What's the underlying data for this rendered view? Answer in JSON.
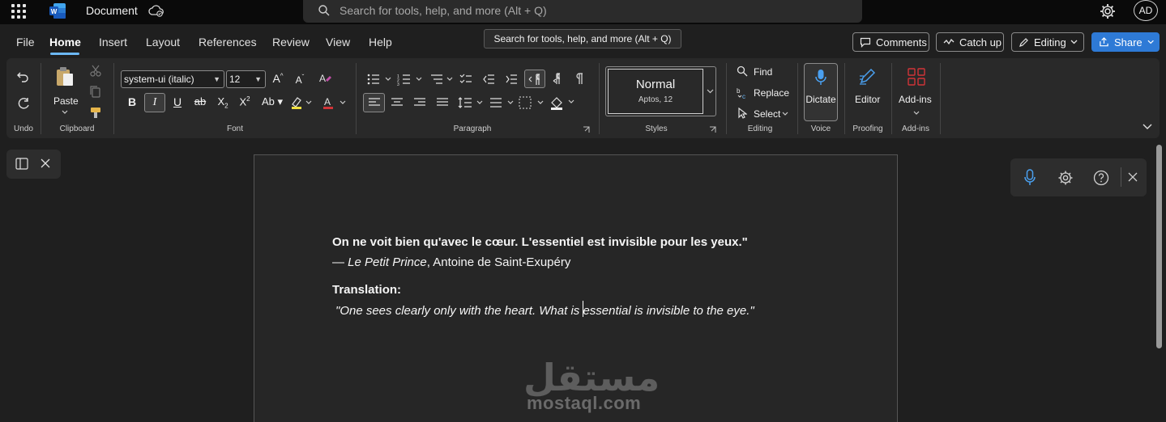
{
  "titlebar": {
    "doc_title": "Document",
    "search_placeholder": "Search for tools, help, and more (Alt + Q)",
    "avatar_initials": "AD"
  },
  "tooltip": "Search for tools, help, and more (Alt + Q)",
  "menu": {
    "tabs": [
      "File",
      "Home",
      "Insert",
      "Layout",
      "References",
      "Review",
      "View",
      "Help"
    ],
    "active": "Home",
    "comments": "Comments",
    "catch_up": "Catch up",
    "editing": "Editing",
    "share": "Share"
  },
  "ribbon": {
    "undo_label": "Undo",
    "paste_label": "Paste",
    "clipboard_label": "Clipboard",
    "font_name": "system-ui (italic)",
    "font_size": "12",
    "font_label": "Font",
    "paragraph_label": "Paragraph",
    "style_name": "Normal",
    "style_sub": "Aptos, 12",
    "styles_label": "Styles",
    "find": "Find",
    "replace": "Replace",
    "select": "Select",
    "editing_label": "Editing",
    "dictate": "Dictate",
    "voice_label": "Voice",
    "editor": "Editor",
    "proofing_label": "Proofing",
    "addins": "Add-ins",
    "addins_label": "Add-ins"
  },
  "document": {
    "quote_fr": "On ne voit bien qu'avec le cœur. L'essentiel est invisible pour les yeux.\"",
    "attribution_dash": "— ",
    "attribution_title": "Le Petit Prince",
    "attribution_author": ", Antoine de Saint-Exupéry",
    "translation_heading": "Translation:",
    "translation_text": "\"One sees clearly only with the heart. What is essential is invisible to the eye.\""
  },
  "watermark": {
    "arabic": "مستقل",
    "latin": "mostaql.com"
  },
  "colors": {
    "accent": "#2e7ad6",
    "tab_underline": "#6cb8f6",
    "word_blue": "#185abd",
    "dictate_mic": "#4aa0f0",
    "addins_red": "#d13438"
  }
}
